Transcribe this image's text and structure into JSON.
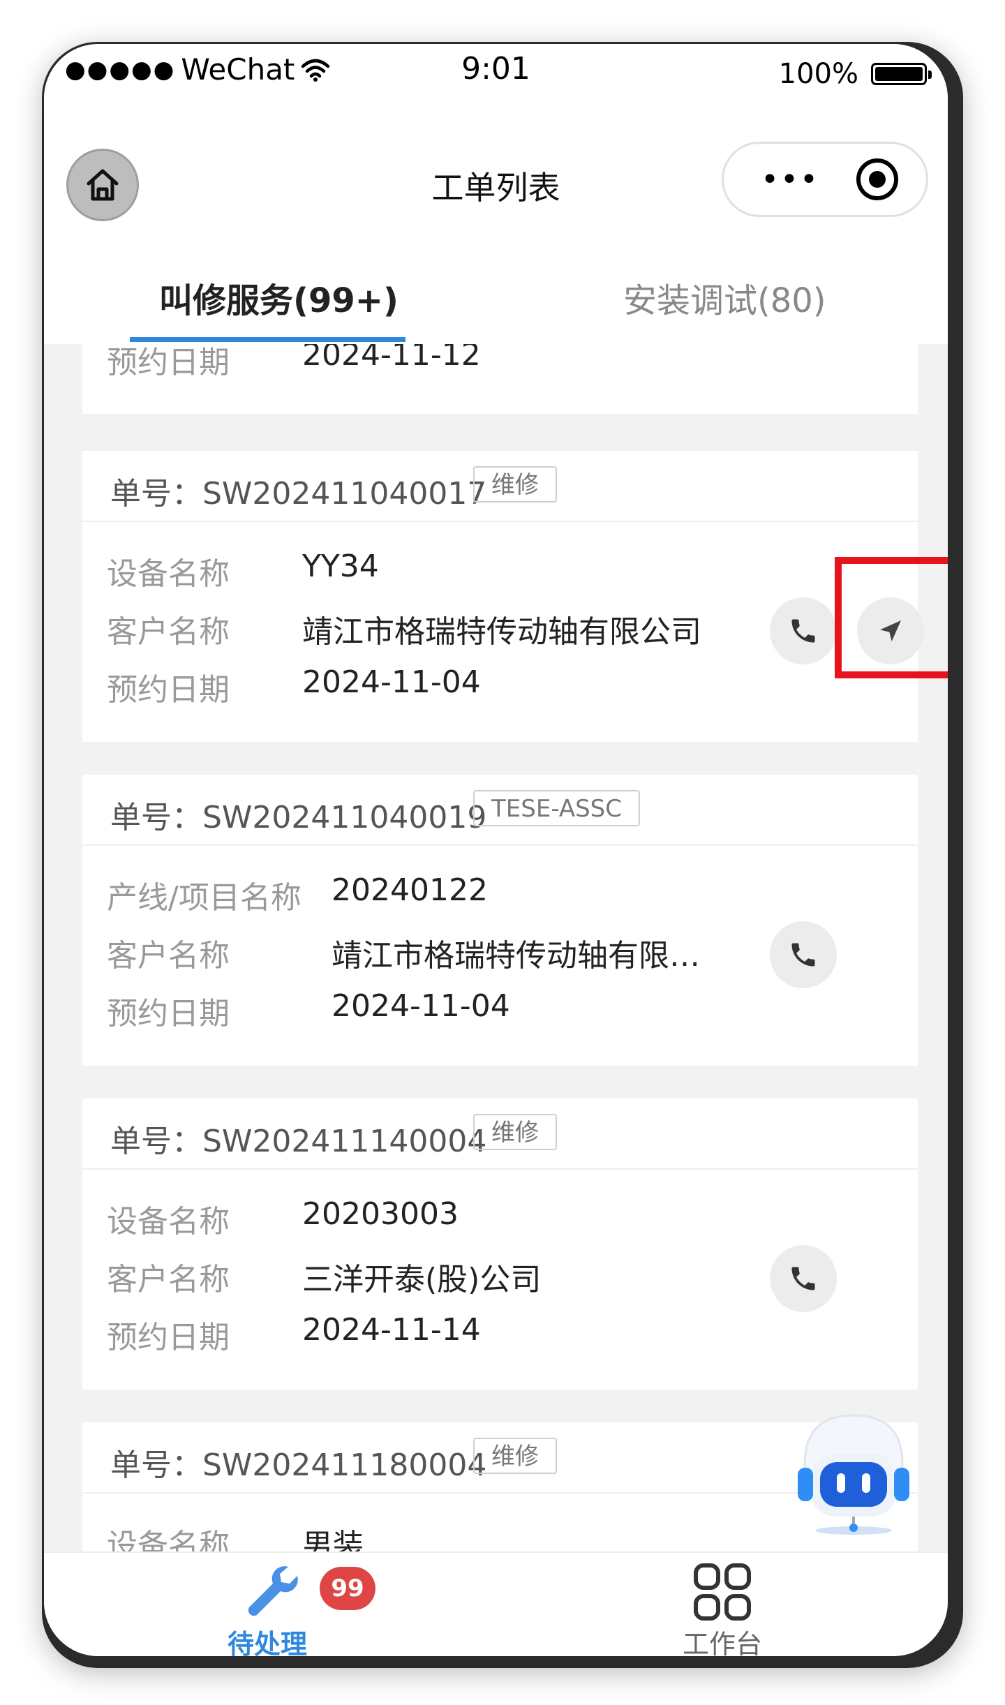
{
  "status_bar": {
    "carrier_dots": "●●●●●",
    "carrier": "WeChat",
    "time": "9:01",
    "battery_percent": "100%"
  },
  "nav": {
    "title": "工单列表",
    "more": "•••"
  },
  "tabs": [
    {
      "label": "叫修服务(99+)",
      "active": true
    },
    {
      "label": "安装调试(80)",
      "active": false
    }
  ],
  "partial_card": {
    "date_label": "预约日期",
    "date_value": "2024-11-12"
  },
  "orders": [
    {
      "order_prefix": "单号：",
      "order_no": "SW202411040017",
      "tag": "维修",
      "f1_label": "设备名称",
      "f1_value": "YY34",
      "f2_label": "客户名称",
      "f2_value": "靖江市格瑞特传动轴有限公司",
      "f3_label": "预约日期",
      "f3_value": "2024-11-04"
    },
    {
      "order_prefix": "单号：",
      "order_no": "SW202411040019",
      "tag": "TESE-ASSC",
      "f1_label": "产线/项目名称",
      "f1_value": "20240122",
      "f2_label": "客户名称",
      "f2_value": "靖江市格瑞特传动轴有限…",
      "f3_label": "预约日期",
      "f3_value": "2024-11-04"
    },
    {
      "order_prefix": "单号：",
      "order_no": "SW202411140004",
      "tag": "维修",
      "f1_label": "设备名称",
      "f1_value": "20203003",
      "f2_label": "客户名称",
      "f2_value": "三洋开泰(股)公司",
      "f3_label": "预约日期",
      "f3_value": "2024-11-14"
    },
    {
      "order_prefix": "单号：",
      "order_no": "SW202411180004",
      "tag": "维修",
      "f1_label": "设备名称",
      "f1_value": "男装"
    }
  ],
  "tabbar": {
    "pending_label": "待处理",
    "pending_badge": "99",
    "workbench_label": "工作台"
  },
  "colors": {
    "accent": "#2f87e0",
    "highlight": "#e8141d",
    "badge": "#e04545"
  }
}
